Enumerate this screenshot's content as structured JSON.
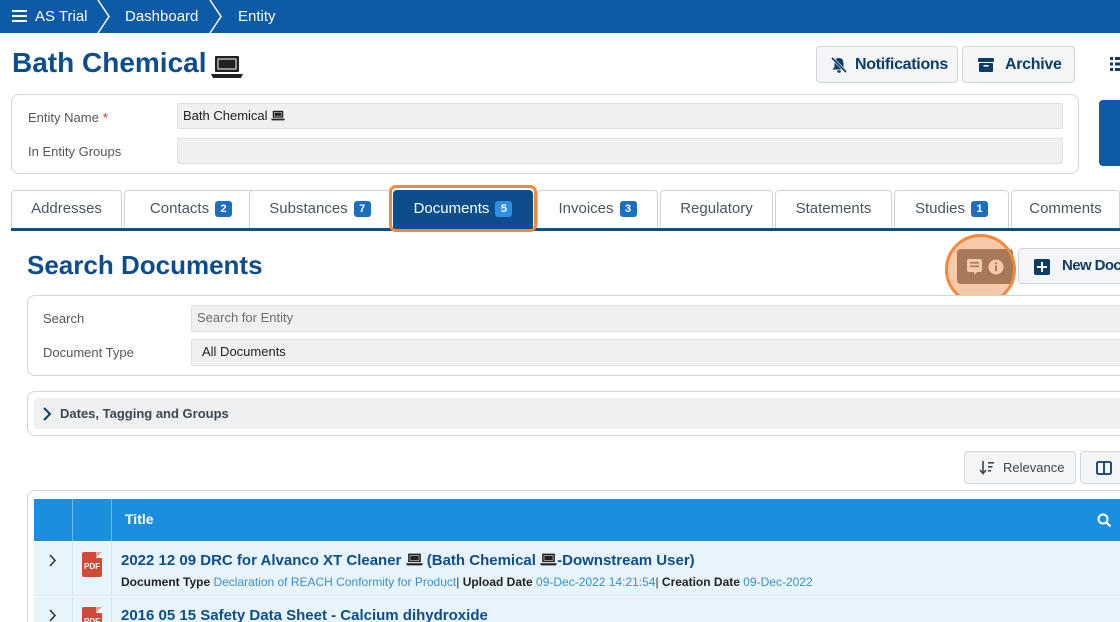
{
  "breadcrumb": {
    "items": [
      "AS Trial",
      "Dashboard",
      "Entity"
    ]
  },
  "header": {
    "title": "Bath Chemical",
    "title_icon": "laptop-icon",
    "notifications_label": "Notifications",
    "archive_label": "Archive"
  },
  "entity": {
    "name_label": "Entity Name",
    "required_mark": "*",
    "name_value": "Bath Chemical",
    "groups_label": "In Entity Groups",
    "groups_value": ""
  },
  "tabs": [
    {
      "label": "Addresses",
      "badge": ""
    },
    {
      "label": "Contacts",
      "badge": "2"
    },
    {
      "label": "Substances",
      "badge": "7"
    },
    {
      "label": "Documents",
      "badge": "5",
      "active": true
    },
    {
      "label": "Invoices",
      "badge": "3"
    },
    {
      "label": "Regulatory",
      "badge": ""
    },
    {
      "label": "Statements",
      "badge": ""
    },
    {
      "label": "Studies",
      "badge": "1"
    },
    {
      "label": "Comments",
      "badge": ""
    }
  ],
  "search": {
    "title": "Search Documents",
    "new_doc_label": "New Doc",
    "search_label": "Search",
    "search_placeholder": "Search for Entity",
    "doc_type_label": "Document Type",
    "doc_type_value": "All Documents",
    "filters_label": "Dates, Tagging and Groups",
    "sort_label": "Relevance"
  },
  "table": {
    "title_header": "Title",
    "rows": [
      {
        "title_prefix": "2022 12 09 DRC for Alvanco XT Cleaner",
        "title_mid": "(Bath Chemical",
        "title_suffix": "-Downstream User)",
        "doc_type_label": "Document Type",
        "doc_type": "Declaration of REACH Conformity for Product",
        "upload_label": "Upload Date",
        "upload_date": "09-Dec-2022 14:21:54",
        "creation_label": "Creation Date",
        "creation_date": "09-Dec-2022",
        "file_type": "PDF"
      },
      {
        "title_prefix": "2016 05 15 Safety Data Sheet - Calcium dihydroxide",
        "file_type": "PDF"
      }
    ]
  },
  "colors": {
    "brand_blue": "#0d5aa7",
    "title_blue": "#0d4d8c",
    "table_header": "#1c8fdc",
    "highlight_orange": "#f0883e"
  }
}
